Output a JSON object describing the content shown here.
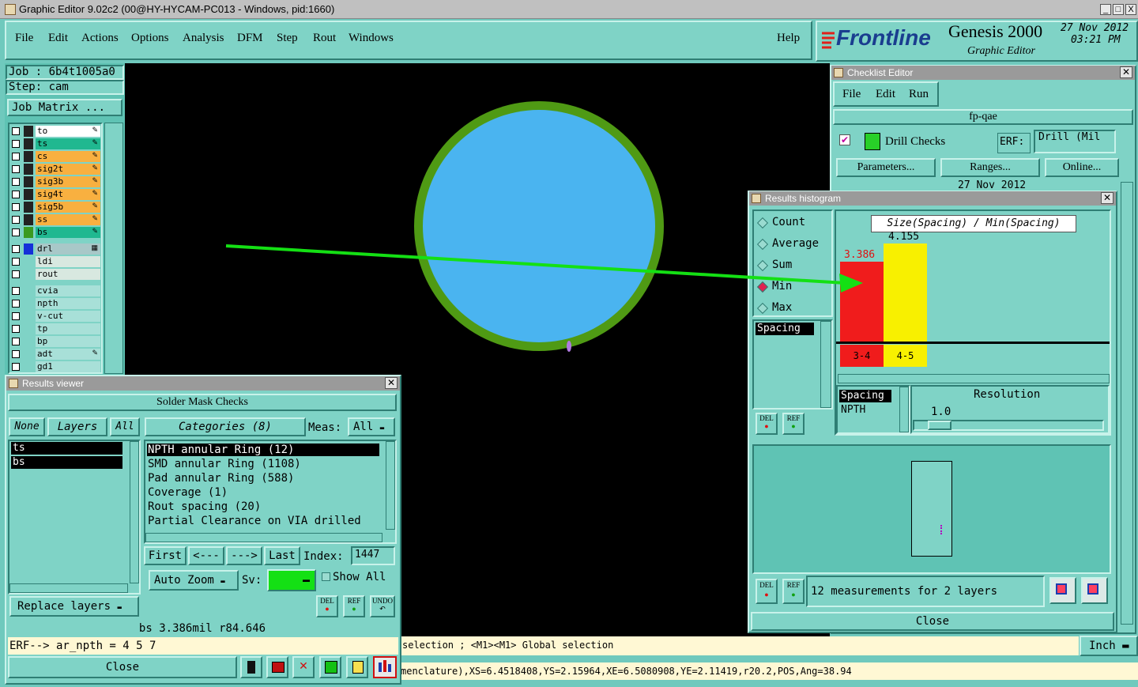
{
  "window": {
    "title": "Graphic Editor 9.02c2 (00@HY-HYCAM-PC013 - Windows, pid:1660)",
    "controls": [
      "_",
      "□",
      "X"
    ]
  },
  "menu": {
    "items": [
      "File",
      "Edit",
      "Actions",
      "Options",
      "Analysis",
      "DFM",
      "Step",
      "Rout",
      "Windows"
    ],
    "help": "Help"
  },
  "brand": {
    "logo": "Frontline",
    "product": "Genesis 2000",
    "subtitle": "Graphic Editor",
    "date": "27 Nov 2012",
    "time": "03:21 PM"
  },
  "job": {
    "job_label": "Job : 6b4t1005a0",
    "step_label": "Step: cam",
    "matrix_button": "Job Matrix ..."
  },
  "layers": {
    "group1": [
      "to",
      "ts",
      "cs",
      "sig2t",
      "sig3b",
      "sig4t",
      "sig5b",
      "ss",
      "bs"
    ],
    "group2": [
      "drl",
      "ldi",
      "rout"
    ],
    "group3": [
      "cvia",
      "npth",
      "v-cut",
      "tp",
      "bp",
      "adt",
      "gd1"
    ]
  },
  "colors": {
    "accent_green": "#14e014",
    "pad_fill": "#4ab4f0",
    "pad_ring": "#4f9a14",
    "bar_red": "#f01c1c",
    "bar_yellow": "#f8f000",
    "background": "#6fc9bd"
  },
  "checklist": {
    "title": "Checklist Editor",
    "menu": [
      "File",
      "Edit",
      "Run"
    ],
    "name": "fp-qae",
    "action": "Drill Checks",
    "erf_label": "ERF:",
    "erf_value": "Drill (Mil",
    "buttons": [
      "Parameters...",
      "Ranges...",
      "Online..."
    ],
    "date": "27 Nov 2012"
  },
  "histogram": {
    "title": "Results histogram",
    "options": [
      "Count",
      "Average",
      "Sum",
      "Min",
      "Max"
    ],
    "selected_option": "Min",
    "list_item": "Spacing",
    "chart_title": "Size(Spacing) / Min(Spacing)",
    "bars": [
      {
        "range": "3-4",
        "value": "3.386",
        "color": "red"
      },
      {
        "range": "4-5",
        "value": "4.155",
        "color": "yellow"
      }
    ],
    "table_header": "Spacing",
    "table_row": "NPTH",
    "resolution_label": "Resolution",
    "resolution_value": "1.0",
    "del": "DEL",
    "ref": "REF",
    "status": "12 measurements for 2 layers",
    "close": "Close"
  },
  "results_viewer": {
    "title": "Results viewer",
    "header": "Solder Mask Checks",
    "none": "None",
    "layers": "Layers",
    "all": "All",
    "categories": "Categories (8)",
    "meas_label": "Meas:",
    "meas_value": "All",
    "layer_list": [
      "ts",
      "bs"
    ],
    "category_list": [
      "NPTH annular Ring (12)",
      "SMD annular Ring (1108)",
      "Pad annular Ring (588)",
      "Coverage (1)",
      "Rout spacing (20)",
      "Partial Clearance on VIA drilled"
    ],
    "nav": [
      "First",
      "<---",
      "--->",
      "Last"
    ],
    "index_label": "Index:",
    "index_value": "1447",
    "auto_zoom": "Auto Zoom",
    "sv_label": "Sv:",
    "show_all": "Show All",
    "replace_layers": "Replace layers",
    "del": "DEL",
    "ref": "REF",
    "undo": "UNDO",
    "measure": "bs 3.386mil   r84.646",
    "erf_line": "ERF--> ar_npth = 4 5 7",
    "close": "Close"
  },
  "status_bar": {
    "hint": "selection ; <M1><M1> Global selection",
    "units": "Inch",
    "coords": "menclature),XS=6.4518408,YS=2.15964,XE=6.5080908,YE=2.11419,r20.2,POS,Ang=38.94"
  }
}
